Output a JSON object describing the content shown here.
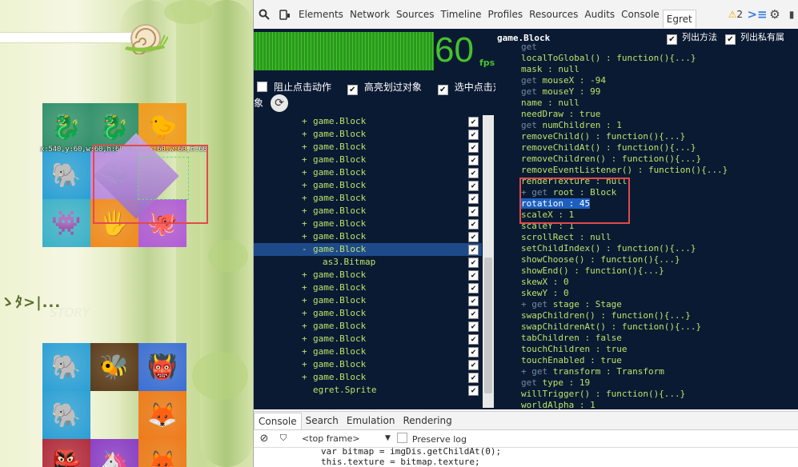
{
  "game": {
    "hud_text": "x:540,y:60,w:60,h:60x:660,y:60,w:60,h:60",
    "side_text": "ゝﾀ>|...",
    "story_text": "STORY",
    "grid_top": [
      "dragon",
      "dragon",
      "duck",
      "blue-creature",
      "whale",
      "",
      "cyan-creature",
      "hand-creature",
      "octopus"
    ],
    "grid_bottom": [
      "blue-creature",
      "bee",
      "blue-monster",
      "blue-creature",
      "",
      "orange-monster",
      "red-creature",
      "purple",
      "orange-monster"
    ]
  },
  "devtools": {
    "tabs": [
      "Elements",
      "Network",
      "Sources",
      "Timeline",
      "Profiles",
      "Resources",
      "Audits",
      "Console",
      "Egret"
    ],
    "active_tab": "Egret",
    "warnings_count": "2",
    "egret": {
      "fps": "60",
      "fps_label": "fps",
      "options": [
        "阻止点击动作",
        "高亮划过对象",
        "选中点击对"
      ],
      "options_wrap": "象",
      "tree": [
        {
          "prefix": "+",
          "label": "game.Block"
        },
        {
          "prefix": "+",
          "label": "game.Block"
        },
        {
          "prefix": "+",
          "label": "game.Block"
        },
        {
          "prefix": "+",
          "label": "game.Block"
        },
        {
          "prefix": "+",
          "label": "game.Block"
        },
        {
          "prefix": "+",
          "label": "game.Block"
        },
        {
          "prefix": "+",
          "label": "game.Block"
        },
        {
          "prefix": "+",
          "label": "game.Block"
        },
        {
          "prefix": "+",
          "label": "game.Block"
        },
        {
          "prefix": "+",
          "label": "game.Block"
        },
        {
          "prefix": "-",
          "label": "game.Block",
          "selected": true
        },
        {
          "prefix": "",
          "label": "as3.Bitmap",
          "indent": true
        },
        {
          "prefix": "+",
          "label": "game.Block"
        },
        {
          "prefix": "+",
          "label": "game.Block"
        },
        {
          "prefix": "+",
          "label": "game.Block"
        },
        {
          "prefix": "+",
          "label": "game.Block"
        },
        {
          "prefix": "+",
          "label": "game.Block"
        },
        {
          "prefix": "+",
          "label": "game.Block"
        },
        {
          "prefix": "+",
          "label": "game.Block"
        },
        {
          "prefix": "+",
          "label": "game.Block"
        },
        {
          "prefix": "+",
          "label": "game.Block"
        },
        {
          "prefix": "",
          "label": "egret.Sprite"
        }
      ]
    },
    "props": {
      "title": "game.Block",
      "opt1": "列出方法",
      "opt2": "列出私有属",
      "rows": [
        {
          "g": "get",
          "k": ""
        },
        {
          "g": "",
          "k": "localToGlobal() : function(){...}"
        },
        {
          "g": "",
          "k": "mask : null"
        },
        {
          "g": "get ",
          "k": "mouseX : -94"
        },
        {
          "g": "get ",
          "k": "mouseY : 99"
        },
        {
          "g": "",
          "k": "name : null"
        },
        {
          "g": "",
          "k": "needDraw : true"
        },
        {
          "g": "get ",
          "k": "numChildren : 1"
        },
        {
          "g": "",
          "k": "removeChild() : function(){...}"
        },
        {
          "g": "",
          "k": "removeChildAt() : function(){...}"
        },
        {
          "g": "",
          "k": "removeChildren() : function(){...}"
        },
        {
          "g": "",
          "k": "removeEventListener() : function(){...}"
        },
        {
          "g": "",
          "k": "renderTexture : null"
        },
        {
          "g": "+ get ",
          "k": "root : Block"
        },
        {
          "g": "",
          "k": "rotation : 45",
          "hl": true
        },
        {
          "g": "",
          "k": "scaleX : 1"
        },
        {
          "g": "",
          "k": "scaleY : 1"
        },
        {
          "g": "",
          "k": "scrollRect : null"
        },
        {
          "g": "",
          "k": "setChildIndex() : function(){...}"
        },
        {
          "g": "",
          "k": "showChoose() : function(){...}"
        },
        {
          "g": "",
          "k": "showEnd() : function(){...}"
        },
        {
          "g": "",
          "k": "skewX : 0"
        },
        {
          "g": "",
          "k": "skewY : 0"
        },
        {
          "g": "+ get ",
          "k": "stage : Stage"
        },
        {
          "g": "",
          "k": "swapChildren() : function(){...}"
        },
        {
          "g": "",
          "k": "swapChildrenAt() : function(){...}"
        },
        {
          "g": "",
          "k": "tabChildren : false"
        },
        {
          "g": "",
          "k": "touchChildren : true"
        },
        {
          "g": "",
          "k": "touchEnabled : true"
        },
        {
          "g": "+ get ",
          "k": "transform : Transform"
        },
        {
          "g": "get ",
          "k": "type : 19"
        },
        {
          "g": "",
          "k": "willTrigger() : function(){...}"
        },
        {
          "g": "",
          "k": "worldAlpha : 1"
        }
      ]
    },
    "console": {
      "tabs": [
        "Console",
        "Search",
        "Emulation",
        "Rendering"
      ],
      "frame": "<top frame>",
      "preserve_log": "Preserve log",
      "code": "var bitmap = imgDis.getChildAt(0);\nthis.texture = bitmap.texture;"
    }
  }
}
